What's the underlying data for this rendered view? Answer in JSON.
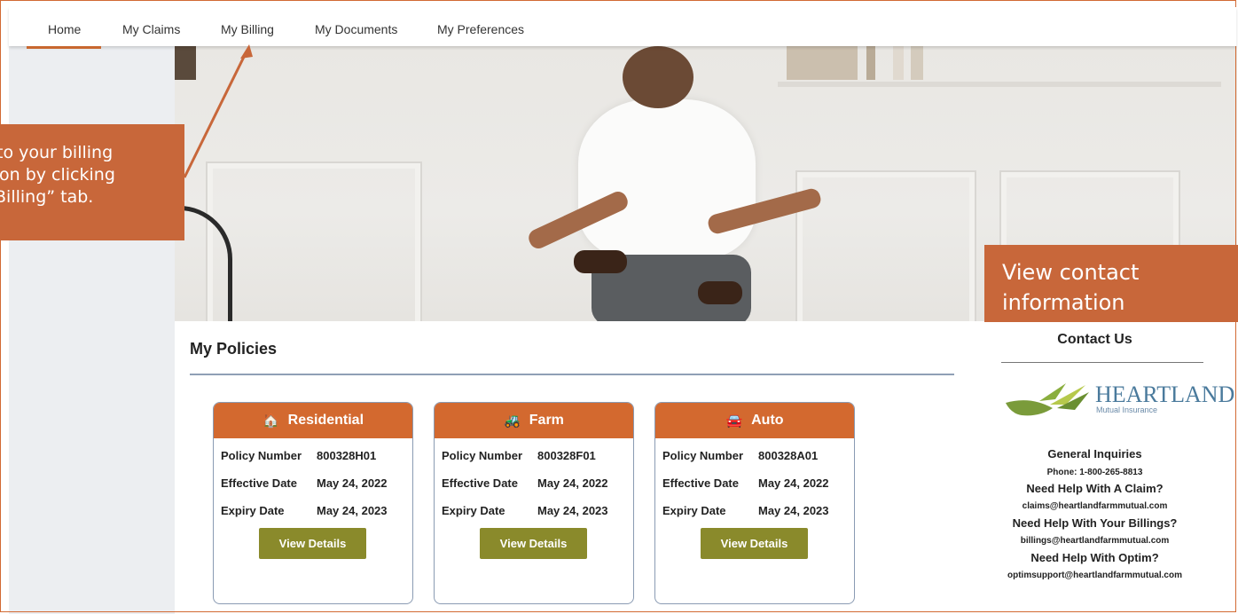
{
  "nav": {
    "tabs": [
      {
        "label": "Home"
      },
      {
        "label": "My Claims"
      },
      {
        "label": "My Billing"
      },
      {
        "label": "My Documents"
      },
      {
        "label": "My Preferences"
      }
    ],
    "active": "Home"
  },
  "annotations": {
    "billing_lines": [
      "to your billing",
      "on by clicking",
      "Billing” tab."
    ],
    "contact_lines": [
      "View contact",
      "information"
    ]
  },
  "policies": {
    "title": "My Policies",
    "cards": [
      {
        "type": "Residential",
        "icon": "home-icon",
        "policy_number_label": "Policy Number",
        "policy_number": "800328H01",
        "effective_label": "Effective Date",
        "effective": "May 24, 2022",
        "expiry_label": "Expiry Date",
        "expiry": "May 24, 2023",
        "button": "View Details"
      },
      {
        "type": "Farm",
        "icon": "tractor-icon",
        "policy_number_label": "Policy Number",
        "policy_number": "800328F01",
        "effective_label": "Effective Date",
        "effective": "May 24, 2022",
        "expiry_label": "Expiry Date",
        "expiry": "May 24, 2023",
        "button": "View Details"
      },
      {
        "type": "Auto",
        "icon": "car-icon",
        "policy_number_label": "Policy Number",
        "policy_number": "800328A01",
        "effective_label": "Effective Date",
        "effective": "May 24, 2022",
        "expiry_label": "Expiry Date",
        "expiry": "May 24, 2023",
        "button": "View Details"
      }
    ]
  },
  "contact": {
    "title": "Contact Us",
    "logo_word": "HEARTLAND",
    "logo_sub": "Mutual Insurance",
    "general": "General Inquiries",
    "phone": "Phone: 1-800-265-8813",
    "claim_q": "Need Help With A Claim?",
    "claim_email": "claims@heartlandfarmmutual.com",
    "billing_q": "Need Help With Your Billings?",
    "billing_email": "billings@heartlandfarmmutual.com",
    "optim_q": "Need Help With Optim?",
    "optim_email": "optimsupport@heartlandfarmmutual.com"
  },
  "colors": {
    "accent": "#d3692f",
    "button": "#8a8a2b",
    "callout": "#c8673a"
  }
}
